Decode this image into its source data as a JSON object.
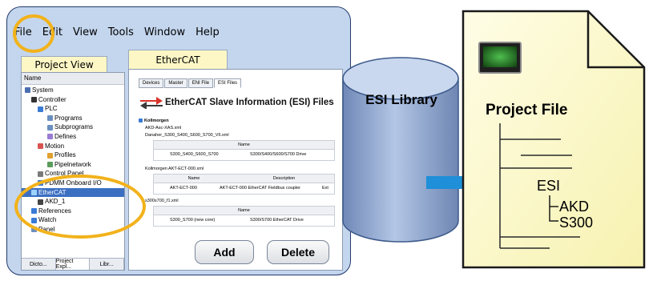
{
  "menu": {
    "items": [
      "File",
      "Edit",
      "View",
      "Tools",
      "Window",
      "Help"
    ]
  },
  "project_view": {
    "tab_label": "Project View",
    "column_header": "Name",
    "tree": [
      {
        "label": "System",
        "depth": 0
      },
      {
        "label": "Controller",
        "depth": 1
      },
      {
        "label": "PLC",
        "depth": 2
      },
      {
        "label": "Programs",
        "depth": 3
      },
      {
        "label": "Subprograms",
        "depth": 3
      },
      {
        "label": "Defines",
        "depth": 3
      },
      {
        "label": "Motion",
        "depth": 2
      },
      {
        "label": "Profiles",
        "depth": 3
      },
      {
        "label": "Pipelnetwork",
        "depth": 3
      },
      {
        "label": "Control Panel",
        "depth": 2
      },
      {
        "label": "PDMM Onboard I/O",
        "depth": 2
      },
      {
        "label": "EtherCAT",
        "depth": 1
      },
      {
        "label": "AKD_1",
        "depth": 2
      },
      {
        "label": "References",
        "depth": 1
      },
      {
        "label": "Watch",
        "depth": 1
      },
      {
        "label": "Panel",
        "depth": 1
      }
    ],
    "bottom_tabs": [
      "Dicto...",
      "Project Expl...",
      "Libr..."
    ]
  },
  "ethercat_panel": {
    "tab_label": "EtherCAT",
    "tabs": [
      "Devices",
      "Master",
      "ENI File",
      "ESI Files"
    ],
    "title": "EtherCAT Slave Information (ESI) Files",
    "esi_tree": {
      "root": "Kollmorgen",
      "file1": "AKD-Asc-XAS.xml",
      "file2": "Danaher_S300_S400_S600_S700_V6.xml",
      "file2_col": "Name",
      "file2_rows": [
        [
          "S300_S400_S600_S700",
          "S300/S400/S600/S700 Drive"
        ]
      ],
      "file3": "Kollmorgen AKT-ECT-000.xml",
      "file3_cols": [
        "Name",
        "Description"
      ],
      "file3_rows": [
        [
          "AKT-ECT-000",
          "AKT-ECT-000 EtherCAT Fieldbus coupler",
          "Ext"
        ]
      ],
      "file4": "s300s700_f1.xml",
      "file4_col": "Name",
      "file4_rows": [
        [
          "S300_S700 (new core)",
          "S300/S700 EtherCAT Drive"
        ]
      ]
    },
    "add_label": "Add",
    "delete_label": "Delete"
  },
  "esi_library_label": "ESI Library",
  "project_file": {
    "title": "Project File",
    "esi": "ESI",
    "children": [
      "AKD",
      "S300"
    ]
  },
  "colors": {
    "highlight_ring": "#f2b21b",
    "arrow": "#1e8fd8",
    "cylinder": "#8ea6cf",
    "paper": "#fdfbc8"
  }
}
